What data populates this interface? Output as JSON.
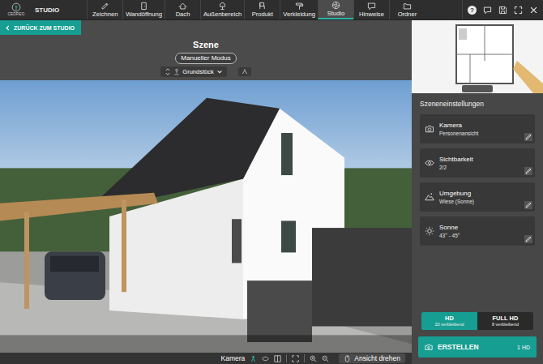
{
  "app": {
    "logo": "CEDREO",
    "section": "STUDIO"
  },
  "nav": [
    {
      "label": "Zeichnen",
      "selected": false
    },
    {
      "label": "Wandöffnung",
      "selected": false
    },
    {
      "label": "Dach",
      "selected": false
    },
    {
      "label": "Außenbereich",
      "selected": false
    },
    {
      "label": "Produkt",
      "selected": false
    },
    {
      "label": "Verkleidung",
      "selected": false
    },
    {
      "label": "Studio",
      "selected": true
    },
    {
      "label": "Hinweise",
      "selected": false
    },
    {
      "label": "Ordner",
      "selected": false
    }
  ],
  "help": "?",
  "back_button": "ZURÜCK ZUM STUDIO",
  "scene": {
    "title": "Szene",
    "mode": "Manueller Modus",
    "view_select": "Grundstück"
  },
  "bottom_bar": {
    "camera_label": "Kamera",
    "rotate_button": "Ansicht drehen"
  },
  "settings": {
    "title": "Szeneneinstellungen",
    "cards": [
      {
        "name": "Kamera",
        "value": "Personenansicht"
      },
      {
        "name": "Sichtbarkeit",
        "value": "2/2"
      },
      {
        "name": "Umgebung",
        "value": "Wiese (Sonne)"
      },
      {
        "name": "Sonne",
        "value": "43° - 45°"
      }
    ]
  },
  "quality": [
    {
      "label": "HD",
      "remaining": "20 verbleibend",
      "selected": true
    },
    {
      "label": "FULL HD",
      "remaining": "8 verbleibend",
      "selected": false
    }
  ],
  "create": {
    "label": "ERSTELLEN",
    "cost": "1 HD"
  }
}
